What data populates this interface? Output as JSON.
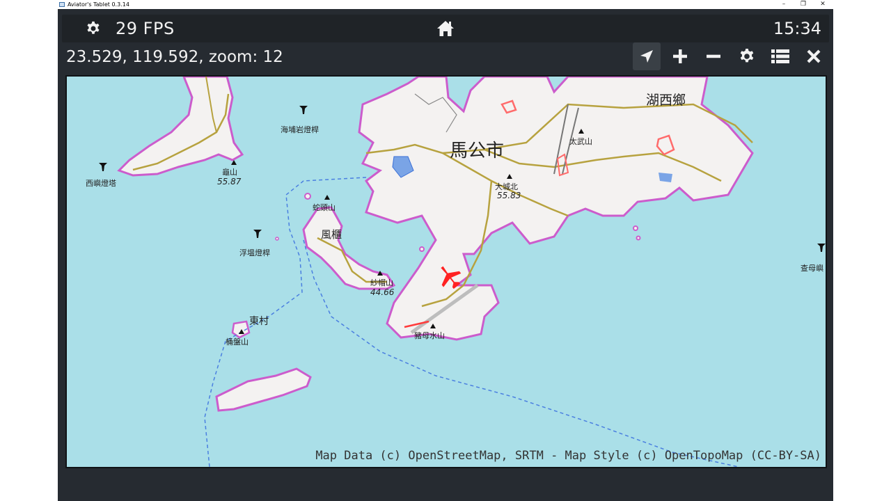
{
  "window": {
    "title": "Aviator's Tablet  0.3.14",
    "controls": [
      "–",
      "❐",
      "✕"
    ]
  },
  "topbar": {
    "fps": "29 FPS",
    "clock": "15:34"
  },
  "status": {
    "coords_text": "23.529, 119.592, zoom: 12"
  },
  "toolbar": {
    "buttons": [
      {
        "icon": "navigation-arrow-icon",
        "active": true
      },
      {
        "icon": "plus-icon"
      },
      {
        "icon": "minus-icon"
      },
      {
        "icon": "gear-icon"
      },
      {
        "icon": "list-icon"
      },
      {
        "icon": "close-icon"
      }
    ]
  },
  "map": {
    "colors": {
      "water": "#aadfe8",
      "land": "#f4f2f1",
      "coast": "#cc5ccc",
      "road": "#b7a23f",
      "runway": "#ff3333"
    },
    "labels": {
      "magong": "馬公市",
      "huxi": "湖西鄉",
      "taiwushan": "太武山",
      "dachengbei": "大城北",
      "dachengbei_ele": "55.83",
      "guishan": "龜山",
      "guishan_ele": "55.87",
      "xiyu_lighthouse": "西嶼燈塔",
      "haigangyan": "海埔岩燈桿",
      "shetoushan": "蛇頭山",
      "fenggui": "風櫃",
      "shamaoshan": "紗帽山",
      "shamaoshan_ele": "44.66",
      "fuchang": "浮塭燈桿",
      "dongcun": "東村",
      "tongpanshan": "桶盤山",
      "zhumushuishan": "豬母水山",
      "chamu": "查母嶼"
    },
    "attribution": "Map Data (c) OpenStreetMap, SRTM - Map Style (c) OpenTopoMap (CC-BY-SA)"
  }
}
